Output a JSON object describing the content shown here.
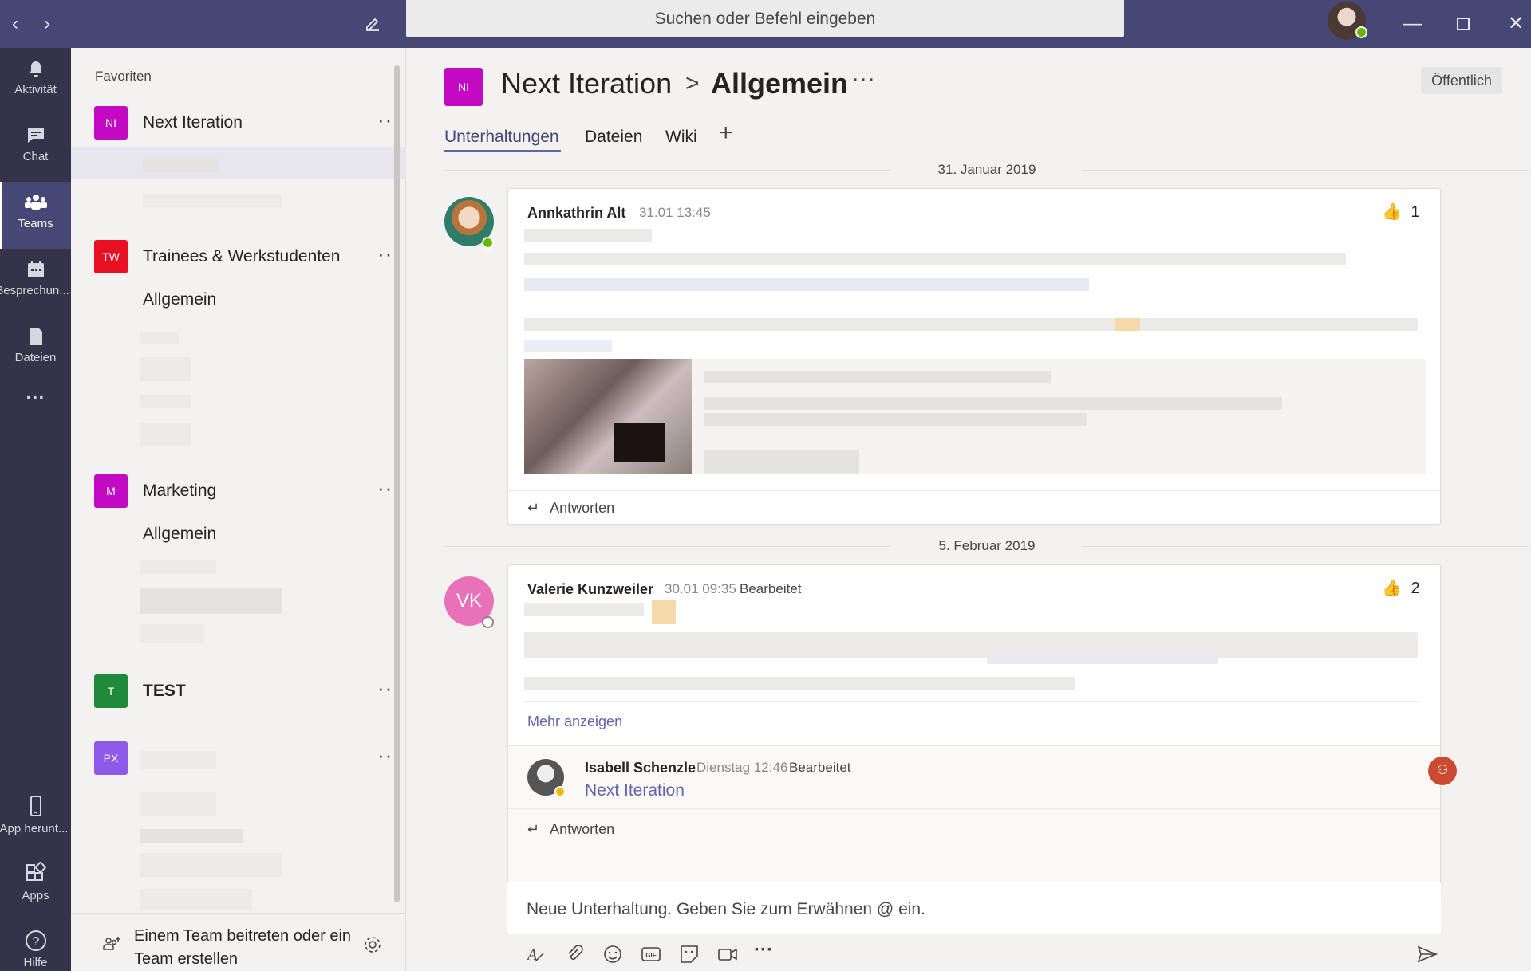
{
  "titlebar": {
    "search_placeholder": "Suchen oder Befehl eingeben",
    "back_icon": "chevron-left-icon",
    "forward_icon": "chevron-right-icon",
    "compose_icon": "compose-icon"
  },
  "rail": {
    "items": [
      {
        "label": "Aktivität",
        "icon": "bell-icon"
      },
      {
        "label": "Chat",
        "icon": "chat-icon"
      },
      {
        "label": "Teams",
        "icon": "teams-icon"
      },
      {
        "label": "Besprechun...",
        "icon": "calendar-icon"
      },
      {
        "label": "Dateien",
        "icon": "file-icon"
      }
    ],
    "more_label": "···",
    "bottom": [
      {
        "label": "App herunt...",
        "icon": "mobile-icon"
      },
      {
        "label": "Apps",
        "icon": "apps-icon"
      },
      {
        "label": "Hilfe",
        "icon": "help-icon"
      }
    ]
  },
  "sidebar": {
    "favorites_label": "Favoriten",
    "teams": [
      {
        "initials": "NI",
        "name": "Next Iteration",
        "color": "#c10ac1"
      },
      {
        "initials": "TW",
        "name": "Trainees & Werkstudenten",
        "color": "#e81123",
        "channel": "Allgemein"
      },
      {
        "initials": "M",
        "name": "Marketing",
        "color": "#c10ac1",
        "channel": "Allgemein"
      },
      {
        "initials": "T",
        "name": "TEST",
        "color": "#1e8a3a"
      },
      {
        "initials": "PX",
        "name": "",
        "color": "#8e59e6"
      }
    ],
    "more_label": "···",
    "join_text": "Einem Team beitreten oder ein Team erstellen"
  },
  "channel_header": {
    "team_initials": "NI",
    "team_name": "Next Iteration",
    "separator": ">",
    "channel_name": "Allgemein",
    "more": "···",
    "visibility": "Öffentlich",
    "tabs": [
      "Unterhaltungen",
      "Dateien",
      "Wiki"
    ],
    "add_tab": "+"
  },
  "posts": [
    {
      "date": "31. Januar 2019",
      "author": "Annkathrin Alt",
      "time": "31.01 13:45",
      "likes": "1",
      "reply_label": "Antworten"
    },
    {
      "date": "5. Februar 2019",
      "author": "Valerie Kunzweiler",
      "initials": "VK",
      "time": "30.01 09:35",
      "edited": "Bearbeitet",
      "likes": "2",
      "show_more": "Mehr anzeigen",
      "reply": {
        "author": "Isabell Schenzle",
        "time": "Dienstag 12:46",
        "edited": "Bearbeitet",
        "mention": "Next Iteration"
      },
      "reply_label": "Antworten"
    }
  ],
  "composer": {
    "placeholder": "Neue Unterhaltung. Geben Sie zum Erwähnen @ ein.",
    "tools": [
      "format-icon",
      "attach-icon",
      "emoji-icon",
      "gif-icon",
      "sticker-icon",
      "meet-icon",
      "more-icon"
    ],
    "send_icon": "send-icon"
  },
  "colors": {
    "titlebar": "#464775",
    "rail": "#33344a",
    "accent": "#6264a7",
    "online": "#6bb700"
  }
}
